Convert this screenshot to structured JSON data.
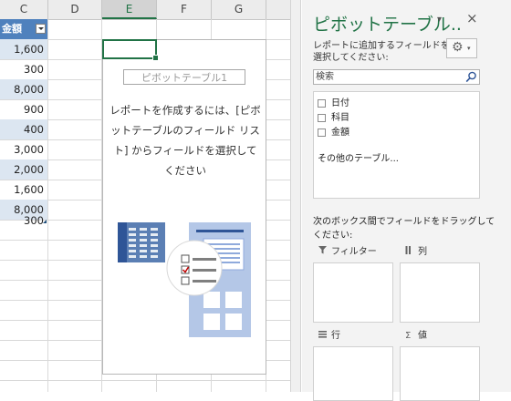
{
  "sheet": {
    "columns": [
      "C",
      "D",
      "E",
      "F",
      "G"
    ],
    "active_column": "E",
    "table_header": "金額",
    "values": [
      "1,600",
      "300",
      "8,000",
      "900",
      "400",
      "3,000",
      "2,000",
      "1,600",
      "8,000",
      "300"
    ],
    "pivot_placeholder": {
      "name": "ピボットテーブル1",
      "message": "レポートを作成するには、[ピボットテーブルのフィールド リスト] からフィールドを選択してください"
    }
  },
  "pane": {
    "title": "ピボットテーブル..",
    "close_glyph": "×",
    "dropdown_glyph": "▾",
    "subtitle": "レポートに追加するフィールドを選択してください:",
    "gear_glyph": "⚙",
    "search_placeholder": "検索",
    "fields": [
      "日付",
      "科目",
      "金額"
    ],
    "more_tables": "その他のテーブル...",
    "drag_hint": "次のボックス間でフィールドをドラッグしてください:",
    "areas": {
      "filter": "フィルター",
      "columns": "列",
      "rows": "行",
      "values": "値"
    },
    "area_icons": {
      "filter": "filter-icon",
      "columns": "columns-icon",
      "rows": "rows-icon",
      "values": "sigma-icon"
    }
  },
  "colors": {
    "accent": "#217346",
    "table_header": "#4f81bd",
    "table_band": "#dce6f1"
  }
}
